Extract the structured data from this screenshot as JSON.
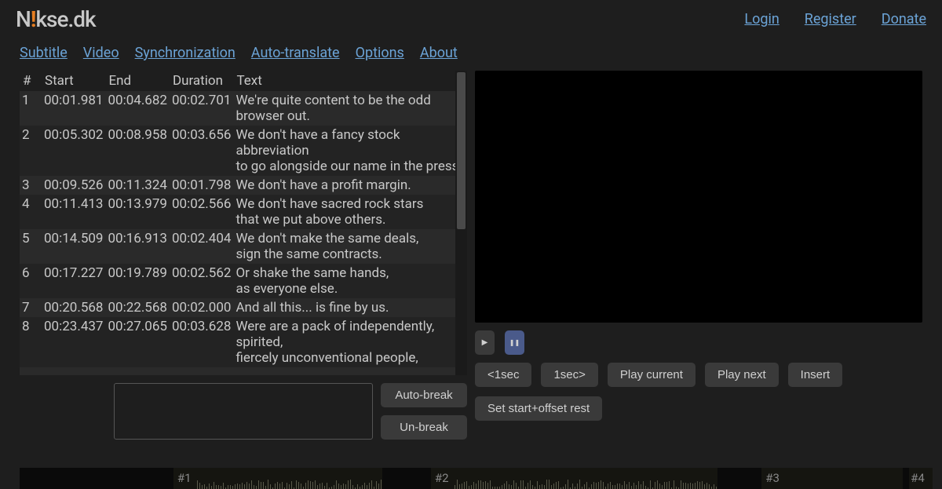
{
  "header": {
    "logo_parts": [
      "N",
      "kse.dk"
    ],
    "links": {
      "login": "Login",
      "register": "Register",
      "donate": "Donate"
    }
  },
  "nav": {
    "subtitle": "Subtitle",
    "video": "Video",
    "synchronization": "Synchronization",
    "auto_translate": "Auto-translate",
    "options": "Options",
    "about": "About"
  },
  "table": {
    "headers": {
      "num": "#",
      "start": "Start",
      "end": "End",
      "duration": "Duration",
      "text": "Text"
    },
    "rows": [
      {
        "num": "1",
        "start": "00:01.981",
        "end": "00:04.682",
        "duration": "00:02.701",
        "text": "We're quite content to be the odd\nbrowser out."
      },
      {
        "num": "2",
        "start": "00:05.302",
        "end": "00:08.958",
        "duration": "00:03.656",
        "text": "We don't have a fancy stock abbreviation\nto go alongside our name in the press."
      },
      {
        "num": "3",
        "start": "00:09.526",
        "end": "00:11.324",
        "duration": "00:01.798",
        "text": "We don't have a profit margin."
      },
      {
        "num": "4",
        "start": "00:11.413",
        "end": "00:13.979",
        "duration": "00:02.566",
        "text": "We don't have sacred rock stars\nthat we put above others."
      },
      {
        "num": "5",
        "start": "00:14.509",
        "end": "00:16.913",
        "duration": "00:02.404",
        "text": "We don't make the same deals,\nsign the same contracts."
      },
      {
        "num": "6",
        "start": "00:17.227",
        "end": "00:19.789",
        "duration": "00:02.562",
        "text": "Or shake the same hands,\nas everyone else."
      },
      {
        "num": "7",
        "start": "00:20.568",
        "end": "00:22.568",
        "duration": "00:02.000",
        "text": "And all this... is fine by us."
      },
      {
        "num": "8",
        "start": "00:23.437",
        "end": "00:27.065",
        "duration": "00:03.628",
        "text": "Were are a pack of independently,\nspirited,\nfiercely unconventional people,"
      }
    ]
  },
  "editor": {
    "text_value": "",
    "auto_break": "Auto-break",
    "un_break": "Un-break"
  },
  "playback": {
    "play_icon": "▶",
    "pause_icon": "❚❚",
    "back_1sec": "<1sec",
    "fwd_1sec": "1sec>",
    "play_current": "Play current",
    "play_next": "Play next",
    "insert": "Insert",
    "set_start_offset": "Set start+offset rest"
  },
  "waveform": {
    "segments": [
      "#1",
      "#2",
      "#3",
      "#4"
    ]
  }
}
